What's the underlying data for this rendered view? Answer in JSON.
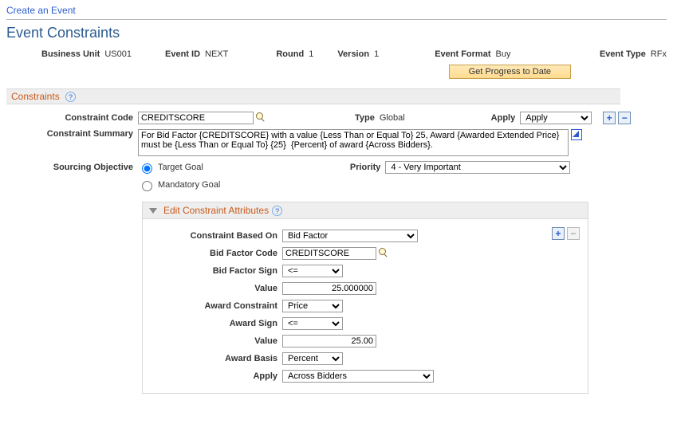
{
  "nav": {
    "create_event": "Create an Event"
  },
  "title": "Event Constraints",
  "header": {
    "bu_label": "Business Unit",
    "bu_value": "US001",
    "event_id_label": "Event ID",
    "event_id_value": "NEXT",
    "round_label": "Round",
    "round_value": "1",
    "version_label": "Version",
    "version_value": "1",
    "format_label": "Event Format",
    "format_value": "Buy",
    "type_label": "Event Type",
    "type_value": "RFx",
    "progress_btn": "Get Progress to Date"
  },
  "section": {
    "constraints_title": "Constraints"
  },
  "form": {
    "code_label": "Constraint Code",
    "code_value": "CREDITSCORE",
    "type_label": "Type",
    "type_value": "Global",
    "apply_label": "Apply",
    "apply_value": "Apply",
    "summary_label": "Constraint Summary",
    "summary_value": "For Bid Factor {CREDITSCORE} with a value {Less Than or Equal To} 25, Award {Awarded Extended Price} must be {Less Than or Equal To} {25}  {Percent} of award {Across Bidders}.",
    "sourcing_label": "Sourcing Objective",
    "target_goal": "Target Goal",
    "mandatory_goal": "Mandatory Goal",
    "priority_label": "Priority",
    "priority_value": "4 - Very Important"
  },
  "attrib": {
    "toggle_title": "Edit Constraint Attributes",
    "based_on_label": "Constraint Based On",
    "based_on_value": "Bid Factor",
    "bf_code_label": "Bid Factor Code",
    "bf_code_value": "CREDITSCORE",
    "bf_sign_label": "Bid Factor Sign",
    "bf_sign_value": "<=",
    "value1_label": "Value",
    "value1_value": "25.000000",
    "award_constraint_label": "Award Constraint",
    "award_constraint_value": "Price",
    "award_sign_label": "Award Sign",
    "award_sign_value": "<=",
    "value2_label": "Value",
    "value2_value": "25.00",
    "award_basis_label": "Award Basis",
    "award_basis_value": "Percent",
    "apply_label": "Apply",
    "apply_value": "Across Bidders"
  }
}
